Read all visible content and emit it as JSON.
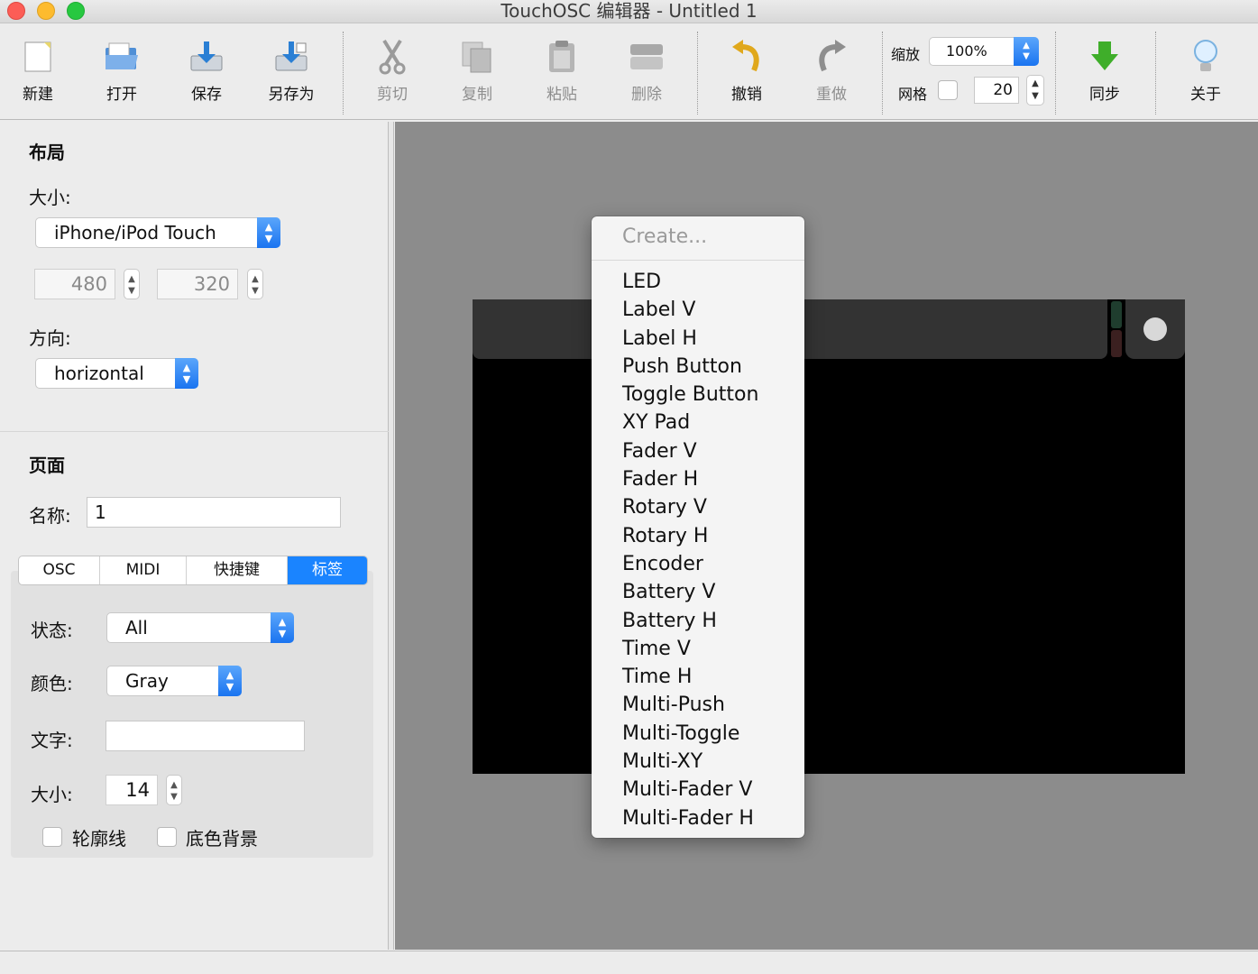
{
  "window": {
    "title": "TouchOSC 编辑器 - Untitled 1"
  },
  "toolbar": {
    "new": "新建",
    "open": "打开",
    "save": "保存",
    "save_as": "另存为",
    "cut": "剪切",
    "copy": "复制",
    "paste": "粘贴",
    "delete": "删除",
    "undo": "撤销",
    "redo": "重做",
    "zoom_label": "缩放",
    "zoom_value": "100%",
    "grid_label": "网格",
    "grid_value": "20",
    "sync": "同步",
    "about": "关于"
  },
  "layout": {
    "section_title": "布局",
    "size_label": "大小:",
    "size_value": "iPhone/iPod Touch",
    "width": "480",
    "height": "320",
    "orientation_label": "方向:",
    "orientation_value": "horizontal"
  },
  "page": {
    "section_title": "页面",
    "name_label": "名称:",
    "name_value": "1",
    "tabs": [
      "OSC",
      "MIDI",
      "快捷键",
      "标签"
    ],
    "active_tab": "标签",
    "state_label": "状态:",
    "state_value": "All",
    "color_label": "颜色:",
    "color_value": "Gray",
    "text_label": "文字:",
    "text_value": "",
    "font_size_label": "大小:",
    "font_size_value": "14",
    "outline_label": "轮廓线",
    "background_label": "底色背景"
  },
  "context_menu": {
    "header": "Create...",
    "items": [
      "LED",
      "Label V",
      "Label H",
      "Push Button",
      "Toggle Button",
      "XY Pad",
      "Fader V",
      "Fader H",
      "Rotary V",
      "Rotary H",
      "Encoder",
      "Battery V",
      "Battery H",
      "Time V",
      "Time H",
      "Multi-Push",
      "Multi-Toggle",
      "Multi-XY",
      "Multi-Fader V",
      "Multi-Fader H"
    ]
  },
  "colors": {
    "accent": "#1a84ff",
    "canvas_bg": "#8c8c8c",
    "device_bg": "#000000"
  }
}
